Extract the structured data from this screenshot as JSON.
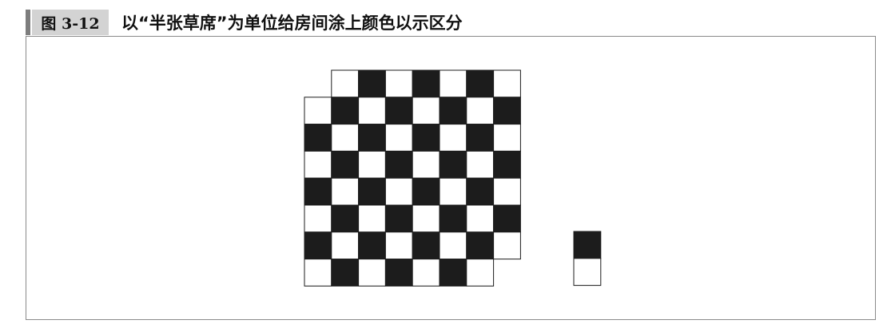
{
  "caption": {
    "label": "图 3-12",
    "title": "以“半张草席”为单位给房间涂上颜色以示区分"
  },
  "board": {
    "rows": 8,
    "cols": 8,
    "missing_corners": [
      "top-left",
      "bottom-right"
    ],
    "pattern": "checkerboard",
    "dark_color": "#1c1c1c",
    "light_color": "#ffffff"
  },
  "tatami_piece": {
    "cells": 2,
    "orientation": "vertical",
    "colors": [
      "#1c1c1c",
      "#ffffff"
    ]
  }
}
